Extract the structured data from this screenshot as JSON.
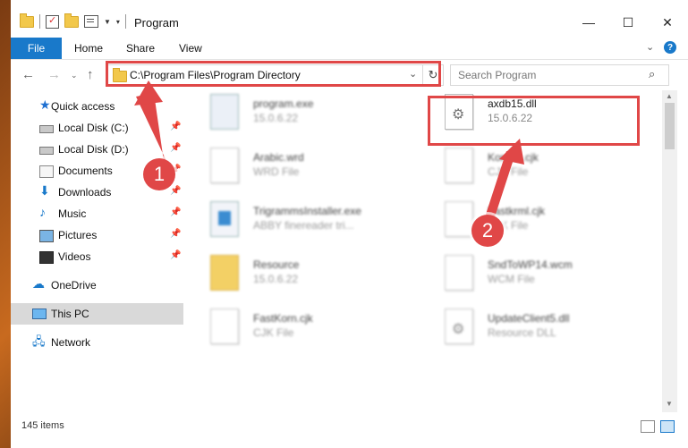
{
  "window": {
    "title": "Program",
    "controls": {
      "minimize": "—",
      "maximize": "☐",
      "close": "✕"
    }
  },
  "ribbon": {
    "tabs": [
      "File",
      "Home",
      "Share",
      "View"
    ]
  },
  "address": {
    "path": "C:\\Program Files\\Program Directory",
    "search_placeholder": "Search Program"
  },
  "nav": {
    "items": [
      {
        "label": "Quick access",
        "icon": "star-icon",
        "pinned": false
      },
      {
        "label": "Local Disk (C:)",
        "icon": "drive-icon",
        "pinned": true
      },
      {
        "label": "Local Disk (D:)",
        "icon": "drive-icon",
        "pinned": true
      },
      {
        "label": "Documents",
        "icon": "documents-icon",
        "pinned": true
      },
      {
        "label": "Downloads",
        "icon": "downloads-icon",
        "pinned": true
      },
      {
        "label": "Music",
        "icon": "music-icon",
        "pinned": true
      },
      {
        "label": "Pictures",
        "icon": "pictures-icon",
        "pinned": true
      },
      {
        "label": "Videos",
        "icon": "videos-icon",
        "pinned": true
      },
      {
        "label": "OneDrive",
        "icon": "onedrive-icon",
        "pinned": false
      },
      {
        "label": "This PC",
        "icon": "pc-icon",
        "pinned": false,
        "selected": true
      },
      {
        "label": "Network",
        "icon": "network-icon",
        "pinned": false
      }
    ]
  },
  "files": [
    {
      "name": "program.exe",
      "sub": "15.0.6.22",
      "icon": "exe-icon",
      "blurred": true
    },
    {
      "name": "axdb15.dll",
      "sub": "15.0.6.22",
      "icon": "dll-icon",
      "blurred": false
    },
    {
      "name": "Arabic.wrd",
      "sub": "WRD File",
      "icon": "file-icon",
      "blurred": true
    },
    {
      "name": "Korean.cjk",
      "sub": "CJK File",
      "icon": "file-icon",
      "blurred": true
    },
    {
      "name": "TrigrammsInstaller.exe",
      "sub": "ABBY finereader tri...",
      "icon": "installer-icon",
      "blurred": true
    },
    {
      "name": "Fastkrml.cjk",
      "sub": "CJK File",
      "icon": "file-icon",
      "blurred": true
    },
    {
      "name": "Resource",
      "sub": "15.0.6.22",
      "icon": "folder-icon",
      "blurred": true
    },
    {
      "name": "SndToWP14.wcm",
      "sub": "WCM File",
      "icon": "file-icon",
      "blurred": true
    },
    {
      "name": "FastKorn.cjk",
      "sub": "CJK File",
      "icon": "file-icon",
      "blurred": true
    },
    {
      "name": "UpdateClient5.dll",
      "sub": "Resource DLL",
      "icon": "dll-icon",
      "blurred": true
    }
  ],
  "status": {
    "count": "145 items"
  },
  "annotations": [
    {
      "label": "1"
    },
    {
      "label": "2"
    }
  ],
  "colors": {
    "accent": "#1979ca",
    "highlight": "#e04747"
  }
}
